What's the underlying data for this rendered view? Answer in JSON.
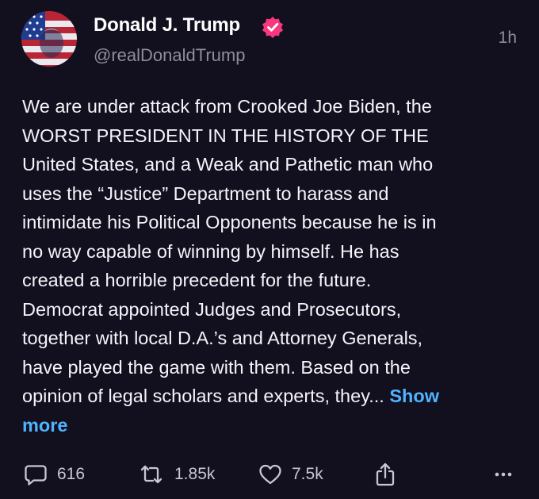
{
  "post": {
    "author": {
      "name": "Donald J. Trump",
      "handle": "@realDonaldTrump",
      "verified_color": "#f7387f"
    },
    "timestamp": "1h",
    "lines": [
      "We are under attack from Crooked Joe Biden, the",
      "WORST PRESIDENT IN THE HISTORY OF THE",
      "United States, and a Weak and Pathetic man who",
      "uses the “Justice” Department to harass and",
      "intimidate his Political Opponents because he is in",
      "no way capable of winning by himself. He has",
      "created a horrible precedent for the future.",
      "Democrat appointed Judges and Prosecutors,",
      "together with local D.A.’s and Attorney Generals,",
      "have played the game with them. Based on the",
      "opinion of legal scholars and experts, they..."
    ],
    "show_more_part1": "Show",
    "show_more_part2": "more",
    "link_color": "#4fb4ff",
    "actions": {
      "replies": "616",
      "reposts": "1.85k",
      "likes": "7.5k"
    },
    "icons": [
      "comment-icon",
      "repost-icon",
      "heart-icon",
      "share-icon",
      "more-icon"
    ]
  }
}
